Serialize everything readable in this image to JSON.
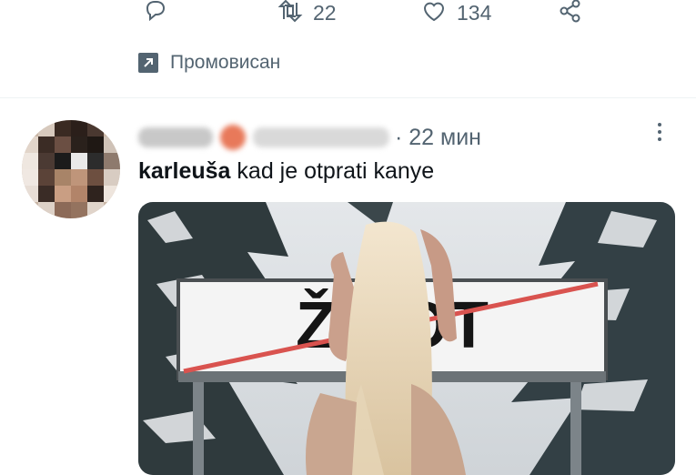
{
  "actions": {
    "reply": {
      "icon": "reply-icon",
      "count": ""
    },
    "retweet": {
      "icon": "retweet-icon",
      "count": "22"
    },
    "like": {
      "icon": "heart-icon",
      "count": "134"
    },
    "share": {
      "icon": "share-icon"
    }
  },
  "promoted": {
    "icon": "promoted-icon",
    "label": "Промовисан"
  },
  "tweet": {
    "time": "· 22 мин",
    "text_bold": "karleuša",
    "text_rest": " kad je otprati kanye",
    "sign_text": "ŽIVOT"
  },
  "colors": {
    "muted": "#536471",
    "text": "#0f1419",
    "divider": "#eff3f4",
    "sign_strike": "#d9534f"
  }
}
